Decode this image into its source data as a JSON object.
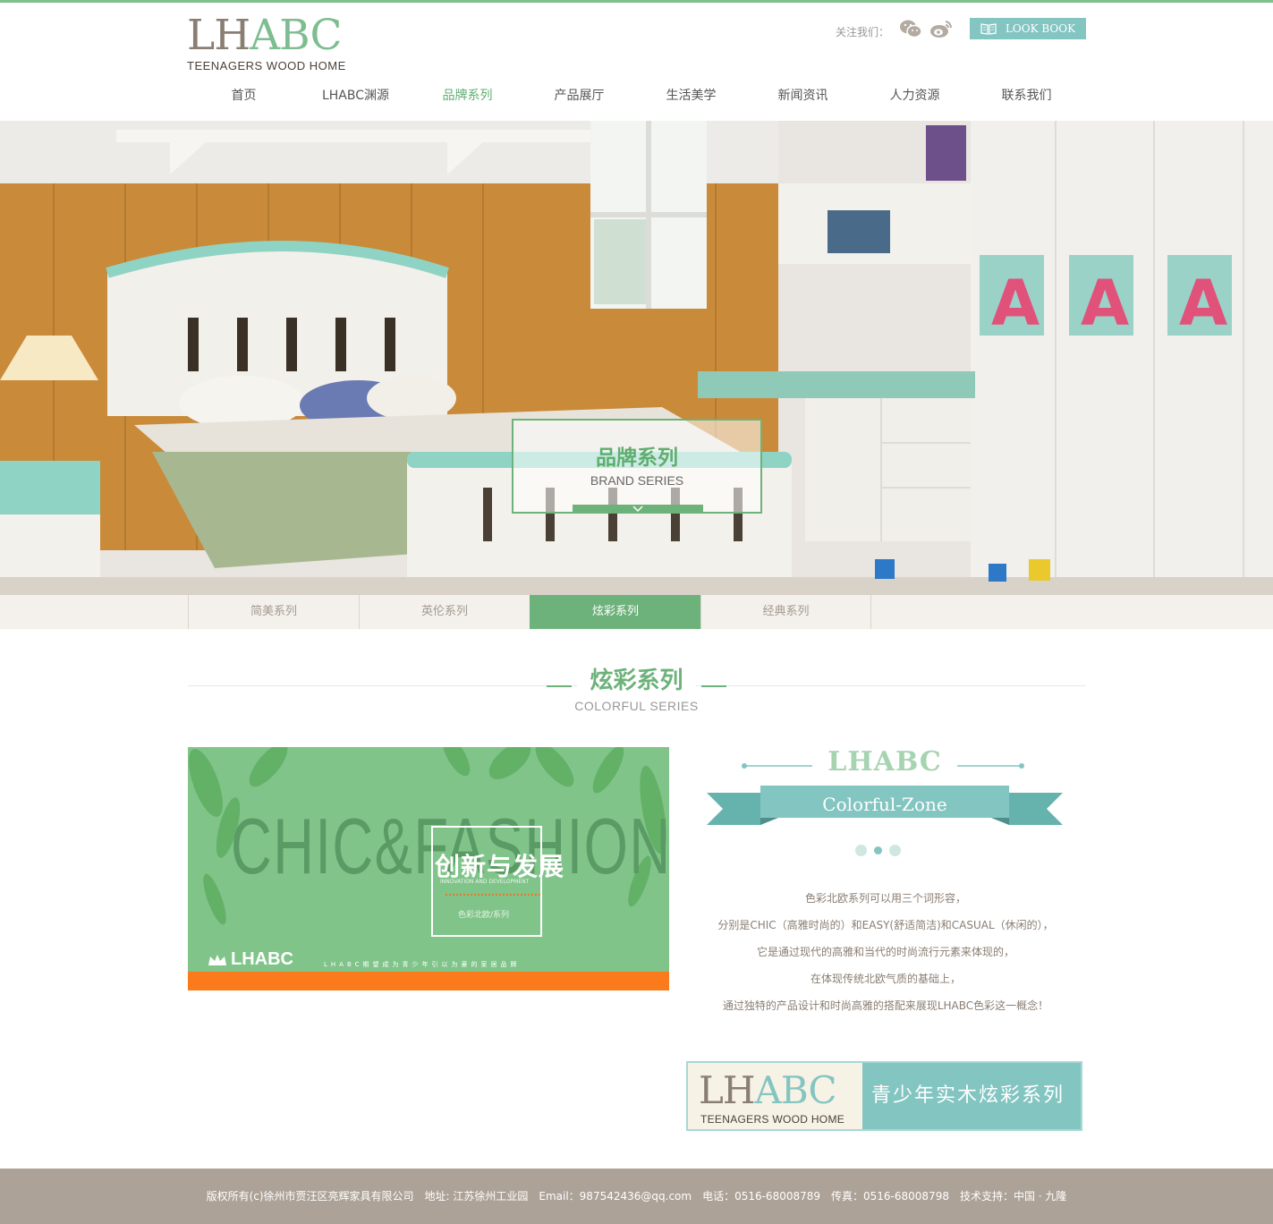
{
  "header": {
    "logo_lh": "LH",
    "logo_abc": "ABC",
    "logo_sub": "TEENAGERS WOOD HOME",
    "follow_label": "关注我们：",
    "lookbook_label": "LOOK BOOK"
  },
  "nav": {
    "items": [
      {
        "label": "首页"
      },
      {
        "label": "LHABC渊源"
      },
      {
        "label": "品牌系列"
      },
      {
        "label": "产品展厅"
      },
      {
        "label": "生活美学"
      },
      {
        "label": "新闻资讯"
      },
      {
        "label": "人力资源"
      },
      {
        "label": "联系我们"
      }
    ],
    "active_index": 2
  },
  "banner": {
    "title": "品牌系列",
    "subtitle": "BRAND SERIES"
  },
  "tabs": {
    "items": [
      {
        "label": "简美系列"
      },
      {
        "label": "英伦系列"
      },
      {
        "label": "炫彩系列"
      },
      {
        "label": "经典系列"
      }
    ],
    "active_index": 2
  },
  "section": {
    "title": "炫彩系列",
    "subtitle": "COLORFUL SERIES"
  },
  "poster": {
    "headline": "CHIC&FASHION",
    "title_cn": "创新与发展",
    "title_en": "INNOVATION AND DEVELOPMENT",
    "subtitle": "色彩北欧/系列",
    "logo": "LHABC",
    "slogan": "LHABC期望成为青少年引以为豪的家居品牌"
  },
  "badge": {
    "brand": "LHABC",
    "ribbon": "Colorful-Zone"
  },
  "description": {
    "lines": [
      "色彩北欧系列可以用三个词形容，",
      "分别是CHIC（高雅时尚的）和EASY(舒适简洁)和CASUAL（休闲的），",
      "它是通过现代的高雅和当代的时尚流行元素来体现的，",
      "在体现传统北欧气质的基础上，",
      "通过独特的产品设计和时尚高雅的搭配来展现LHABC色彩这一概念！"
    ]
  },
  "series_banner": {
    "logo_lh": "LH",
    "logo_abc": "ABC",
    "logo_sub": "TEENAGERS WOOD HOME",
    "title": "青少年实木炫彩系列"
  },
  "footer": {
    "text": "版权所有(c)徐州市贾汪区亮辉家具有限公司　地址: 江苏徐州工业园　Email：987542436@qq.com　电话：0516-68008789　传真：0516-68008798　技术支持：中国 · 九隆"
  },
  "colors": {
    "accent_green": "#6db27a",
    "teal": "#83c5c1",
    "footer_bg": "#ada297",
    "orange": "#fb7a1b"
  }
}
